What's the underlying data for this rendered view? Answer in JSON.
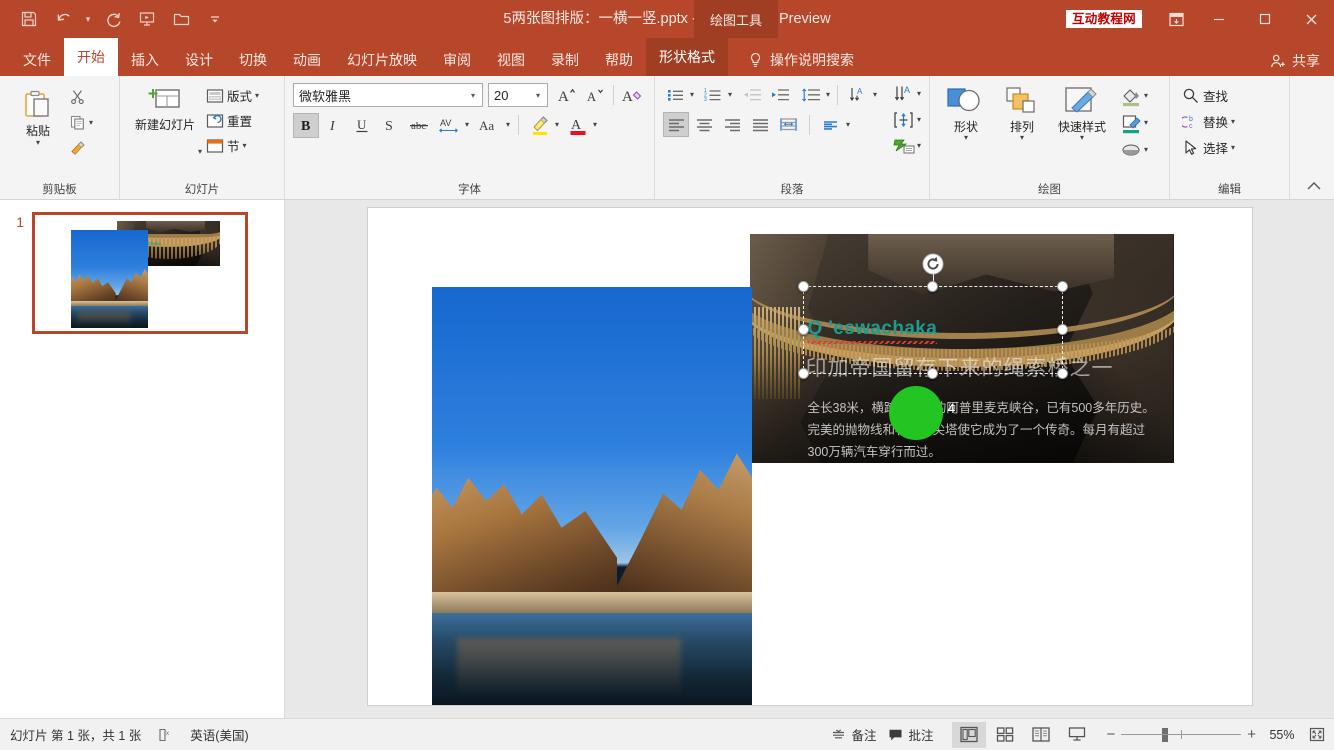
{
  "window": {
    "title": "5两张图排版：一横一竖.pptx  -  PowerPoint Preview",
    "context_tab_group": "绘图工具",
    "watermark_badge": "互动教程网",
    "quick_access": [
      {
        "name": "save",
        "label": "保存"
      },
      {
        "name": "undo",
        "label": "撤消"
      },
      {
        "name": "redo",
        "label": "恢复"
      },
      {
        "name": "start-slideshow",
        "label": "从头开始"
      },
      {
        "name": "open",
        "label": "打开"
      },
      {
        "name": "customize",
        "label": "自定义快速访问工具栏"
      }
    ],
    "controls": {
      "ribbon_display": "功能区显示选项",
      "minimize": "最小化",
      "maximize": "最大化",
      "close": "关闭"
    }
  },
  "tabs": [
    {
      "label": "文件",
      "active": false
    },
    {
      "label": "开始",
      "active": true
    },
    {
      "label": "插入",
      "active": false
    },
    {
      "label": "设计",
      "active": false
    },
    {
      "label": "切换",
      "active": false
    },
    {
      "label": "动画",
      "active": false
    },
    {
      "label": "幻灯片放映",
      "active": false
    },
    {
      "label": "审阅",
      "active": false
    },
    {
      "label": "视图",
      "active": false
    },
    {
      "label": "录制",
      "active": false
    },
    {
      "label": "帮助",
      "active": false
    },
    {
      "label": "形状格式",
      "active": false,
      "contextual": true
    }
  ],
  "tell_me": "操作说明搜索",
  "share": "共享",
  "ribbon": {
    "groups": [
      {
        "name": "clipboard",
        "label": "剪贴板",
        "has_dialog_launcher": true,
        "items": [
          {
            "name": "paste",
            "label": "粘贴",
            "type": "big"
          },
          {
            "name": "cut",
            "label": "剪切",
            "type": "icon"
          },
          {
            "name": "copy",
            "label": "复制",
            "type": "icon"
          },
          {
            "name": "format-painter",
            "label": "格式刷",
            "type": "icon"
          }
        ]
      },
      {
        "name": "slides",
        "label": "幻灯片",
        "has_dialog_launcher": false,
        "items": [
          {
            "name": "new-slide",
            "label": "新建幻灯片",
            "type": "big"
          },
          {
            "name": "layout",
            "label": "版式",
            "type": "small"
          },
          {
            "name": "reset",
            "label": "重置",
            "type": "small"
          },
          {
            "name": "section",
            "label": "节",
            "type": "small"
          }
        ]
      },
      {
        "name": "font",
        "label": "字体",
        "has_dialog_launcher": true,
        "font_family": "微软雅黑",
        "font_size": "20",
        "items": [
          {
            "name": "grow-font",
            "label": "增大字号"
          },
          {
            "name": "shrink-font",
            "label": "减小字号"
          },
          {
            "name": "clear-formatting",
            "label": "清除所有格式"
          },
          {
            "name": "bold",
            "label": "B",
            "active": true
          },
          {
            "name": "italic",
            "label": "I"
          },
          {
            "name": "underline",
            "label": "U"
          },
          {
            "name": "text-shadow",
            "label": "S"
          },
          {
            "name": "strikethrough",
            "label": "abc"
          },
          {
            "name": "character-spacing",
            "label": "AV"
          },
          {
            "name": "change-case",
            "label": "Aa"
          },
          {
            "name": "text-highlight",
            "label": "文本突出显示颜色"
          },
          {
            "name": "font-color",
            "label": "字体颜色"
          }
        ]
      },
      {
        "name": "paragraph",
        "label": "段落",
        "has_dialog_launcher": true,
        "items": [
          {
            "name": "bullets",
            "label": "项目符号"
          },
          {
            "name": "numbering",
            "label": "编号"
          },
          {
            "name": "decrease-indent",
            "label": "减少缩进量"
          },
          {
            "name": "increase-indent",
            "label": "增加缩进量"
          },
          {
            "name": "line-spacing",
            "label": "行距"
          },
          {
            "name": "align-left",
            "label": "左对齐",
            "active": true
          },
          {
            "name": "align-center",
            "label": "居中"
          },
          {
            "name": "align-right",
            "label": "右对齐"
          },
          {
            "name": "justify",
            "label": "两端对齐"
          },
          {
            "name": "columns",
            "label": "分栏"
          },
          {
            "name": "smartart",
            "label": "转换为 SmartArt"
          },
          {
            "name": "text-direction",
            "label": "文字方向"
          },
          {
            "name": "align-text",
            "label": "对齐文本"
          }
        ]
      },
      {
        "name": "drawing",
        "label": "绘图",
        "has_dialog_launcher": true,
        "items": [
          {
            "name": "shapes",
            "label": "形状",
            "type": "big"
          },
          {
            "name": "arrange",
            "label": "排列",
            "type": "big"
          },
          {
            "name": "quick-styles",
            "label": "快速样式",
            "type": "big"
          },
          {
            "name": "shape-fill",
            "label": "形状填充"
          },
          {
            "name": "shape-outline",
            "label": "形状轮廓"
          },
          {
            "name": "shape-effects",
            "label": "形状效果"
          }
        ]
      },
      {
        "name": "editing",
        "label": "编辑",
        "has_dialog_launcher": false,
        "items": [
          {
            "name": "find",
            "label": "查找"
          },
          {
            "name": "replace",
            "label": "替换"
          },
          {
            "name": "select",
            "label": "选择"
          }
        ]
      }
    ],
    "collapse_label": "折叠功能区"
  },
  "thumbnails": [
    {
      "number": "1",
      "selected": true
    }
  ],
  "slide": {
    "title": "Q 'eswachaka",
    "subtitle": "印加帝国留存下来的绳索桥之一",
    "body": "全长38米，横跨宝蓝色的阿普里麦克峡谷，已有500多年历史。完美的抛物线和石灰岩尖塔使它成为了一个传奇。每月有超过300万辆汽车穿行而过。",
    "shape_number": "4",
    "shape_color": "#22c522",
    "accent_color": "#1f9b8e"
  },
  "status": {
    "slide_count": "幻灯片 第 1 张，共 1 张",
    "accessibility": "辅助功能",
    "language": "英语(美国)",
    "notes": "备注",
    "comments": "批注",
    "views": [
      {
        "name": "normal",
        "label": "普通视图",
        "active": true
      },
      {
        "name": "slide-sorter",
        "label": "幻灯片浏览",
        "active": false
      },
      {
        "name": "reading",
        "label": "阅读视图",
        "active": false
      },
      {
        "name": "slideshow",
        "label": "幻灯片放映",
        "active": false
      }
    ],
    "zoom_out": "缩小",
    "zoom_in": "放大",
    "zoom_level": "55%",
    "fit_window": "使幻灯片适应当前窗口"
  },
  "colors": {
    "brand": "#b7472a",
    "brand_dark": "#a03e24",
    "badge_text": "#c00000"
  }
}
